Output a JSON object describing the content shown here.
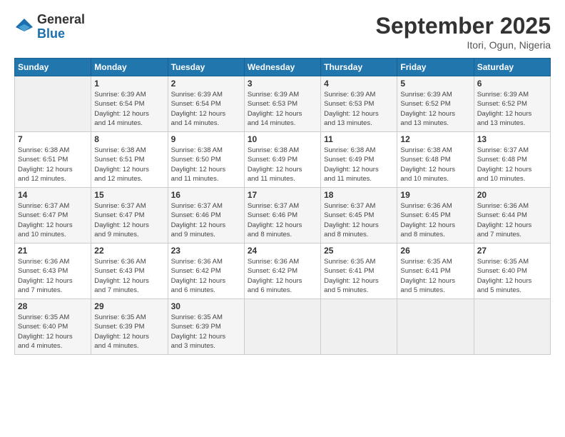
{
  "logo": {
    "general": "General",
    "blue": "Blue"
  },
  "title": "September 2025",
  "location": "Itori, Ogun, Nigeria",
  "weekdays": [
    "Sunday",
    "Monday",
    "Tuesday",
    "Wednesday",
    "Thursday",
    "Friday",
    "Saturday"
  ],
  "weeks": [
    [
      {
        "day": "",
        "sunrise": "",
        "sunset": "",
        "daylight": ""
      },
      {
        "day": "1",
        "sunrise": "Sunrise: 6:39 AM",
        "sunset": "Sunset: 6:54 PM",
        "daylight": "Daylight: 12 hours and 14 minutes."
      },
      {
        "day": "2",
        "sunrise": "Sunrise: 6:39 AM",
        "sunset": "Sunset: 6:54 PM",
        "daylight": "Daylight: 12 hours and 14 minutes."
      },
      {
        "day": "3",
        "sunrise": "Sunrise: 6:39 AM",
        "sunset": "Sunset: 6:53 PM",
        "daylight": "Daylight: 12 hours and 14 minutes."
      },
      {
        "day": "4",
        "sunrise": "Sunrise: 6:39 AM",
        "sunset": "Sunset: 6:53 PM",
        "daylight": "Daylight: 12 hours and 13 minutes."
      },
      {
        "day": "5",
        "sunrise": "Sunrise: 6:39 AM",
        "sunset": "Sunset: 6:52 PM",
        "daylight": "Daylight: 12 hours and 13 minutes."
      },
      {
        "day": "6",
        "sunrise": "Sunrise: 6:39 AM",
        "sunset": "Sunset: 6:52 PM",
        "daylight": "Daylight: 12 hours and 13 minutes."
      }
    ],
    [
      {
        "day": "7",
        "sunrise": "Sunrise: 6:38 AM",
        "sunset": "Sunset: 6:51 PM",
        "daylight": "Daylight: 12 hours and 12 minutes."
      },
      {
        "day": "8",
        "sunrise": "Sunrise: 6:38 AM",
        "sunset": "Sunset: 6:51 PM",
        "daylight": "Daylight: 12 hours and 12 minutes."
      },
      {
        "day": "9",
        "sunrise": "Sunrise: 6:38 AM",
        "sunset": "Sunset: 6:50 PM",
        "daylight": "Daylight: 12 hours and 11 minutes."
      },
      {
        "day": "10",
        "sunrise": "Sunrise: 6:38 AM",
        "sunset": "Sunset: 6:49 PM",
        "daylight": "Daylight: 12 hours and 11 minutes."
      },
      {
        "day": "11",
        "sunrise": "Sunrise: 6:38 AM",
        "sunset": "Sunset: 6:49 PM",
        "daylight": "Daylight: 12 hours and 11 minutes."
      },
      {
        "day": "12",
        "sunrise": "Sunrise: 6:38 AM",
        "sunset": "Sunset: 6:48 PM",
        "daylight": "Daylight: 12 hours and 10 minutes."
      },
      {
        "day": "13",
        "sunrise": "Sunrise: 6:37 AM",
        "sunset": "Sunset: 6:48 PM",
        "daylight": "Daylight: 12 hours and 10 minutes."
      }
    ],
    [
      {
        "day": "14",
        "sunrise": "Sunrise: 6:37 AM",
        "sunset": "Sunset: 6:47 PM",
        "daylight": "Daylight: 12 hours and 10 minutes."
      },
      {
        "day": "15",
        "sunrise": "Sunrise: 6:37 AM",
        "sunset": "Sunset: 6:47 PM",
        "daylight": "Daylight: 12 hours and 9 minutes."
      },
      {
        "day": "16",
        "sunrise": "Sunrise: 6:37 AM",
        "sunset": "Sunset: 6:46 PM",
        "daylight": "Daylight: 12 hours and 9 minutes."
      },
      {
        "day": "17",
        "sunrise": "Sunrise: 6:37 AM",
        "sunset": "Sunset: 6:46 PM",
        "daylight": "Daylight: 12 hours and 8 minutes."
      },
      {
        "day": "18",
        "sunrise": "Sunrise: 6:37 AM",
        "sunset": "Sunset: 6:45 PM",
        "daylight": "Daylight: 12 hours and 8 minutes."
      },
      {
        "day": "19",
        "sunrise": "Sunrise: 6:36 AM",
        "sunset": "Sunset: 6:45 PM",
        "daylight": "Daylight: 12 hours and 8 minutes."
      },
      {
        "day": "20",
        "sunrise": "Sunrise: 6:36 AM",
        "sunset": "Sunset: 6:44 PM",
        "daylight": "Daylight: 12 hours and 7 minutes."
      }
    ],
    [
      {
        "day": "21",
        "sunrise": "Sunrise: 6:36 AM",
        "sunset": "Sunset: 6:43 PM",
        "daylight": "Daylight: 12 hours and 7 minutes."
      },
      {
        "day": "22",
        "sunrise": "Sunrise: 6:36 AM",
        "sunset": "Sunset: 6:43 PM",
        "daylight": "Daylight: 12 hours and 7 minutes."
      },
      {
        "day": "23",
        "sunrise": "Sunrise: 6:36 AM",
        "sunset": "Sunset: 6:42 PM",
        "daylight": "Daylight: 12 hours and 6 minutes."
      },
      {
        "day": "24",
        "sunrise": "Sunrise: 6:36 AM",
        "sunset": "Sunset: 6:42 PM",
        "daylight": "Daylight: 12 hours and 6 minutes."
      },
      {
        "day": "25",
        "sunrise": "Sunrise: 6:35 AM",
        "sunset": "Sunset: 6:41 PM",
        "daylight": "Daylight: 12 hours and 5 minutes."
      },
      {
        "day": "26",
        "sunrise": "Sunrise: 6:35 AM",
        "sunset": "Sunset: 6:41 PM",
        "daylight": "Daylight: 12 hours and 5 minutes."
      },
      {
        "day": "27",
        "sunrise": "Sunrise: 6:35 AM",
        "sunset": "Sunset: 6:40 PM",
        "daylight": "Daylight: 12 hours and 5 minutes."
      }
    ],
    [
      {
        "day": "28",
        "sunrise": "Sunrise: 6:35 AM",
        "sunset": "Sunset: 6:40 PM",
        "daylight": "Daylight: 12 hours and 4 minutes."
      },
      {
        "day": "29",
        "sunrise": "Sunrise: 6:35 AM",
        "sunset": "Sunset: 6:39 PM",
        "daylight": "Daylight: 12 hours and 4 minutes."
      },
      {
        "day": "30",
        "sunrise": "Sunrise: 6:35 AM",
        "sunset": "Sunset: 6:39 PM",
        "daylight": "Daylight: 12 hours and 3 minutes."
      },
      {
        "day": "",
        "sunrise": "",
        "sunset": "",
        "daylight": ""
      },
      {
        "day": "",
        "sunrise": "",
        "sunset": "",
        "daylight": ""
      },
      {
        "day": "",
        "sunrise": "",
        "sunset": "",
        "daylight": ""
      },
      {
        "day": "",
        "sunrise": "",
        "sunset": "",
        "daylight": ""
      }
    ]
  ]
}
